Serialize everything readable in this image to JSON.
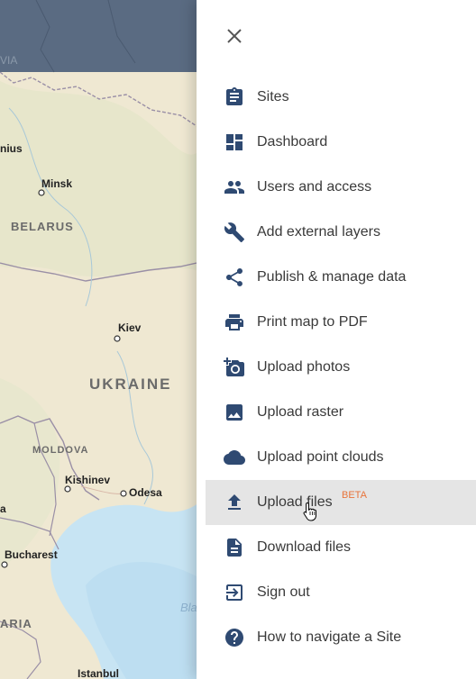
{
  "map": {
    "labels": {
      "via": "VIA",
      "nius": "nius",
      "minsk": "Minsk",
      "belarus": "BELARUS",
      "kiev": "Kiev",
      "ukraine": "UKRAINE",
      "moldova": "MOLDOVA",
      "kishinev": "Kishinev",
      "odesa": "Odesa",
      "bucharest": "Bucharest",
      "aria": "ARIA",
      "bla": "Bla",
      "istanbul": "Istanbul",
      "a": "a"
    },
    "colors": {
      "land": "#efe8d2",
      "water": "#c7e4f3",
      "overlay": "#5a6b82",
      "border": "#9a8fa6"
    }
  },
  "panel": {
    "close_icon": "close-icon",
    "icon_color": "#2f4a72",
    "items": [
      {
        "label": "Sites",
        "icon": "clipboard-icon"
      },
      {
        "label": "Dashboard",
        "icon": "dashboard-icon"
      },
      {
        "label": "Users and access",
        "icon": "users-icon"
      },
      {
        "label": "Add external layers",
        "icon": "wrench-icon"
      },
      {
        "label": "Publish & manage data",
        "icon": "share-icon"
      },
      {
        "label": "Print map to PDF",
        "icon": "printer-icon"
      },
      {
        "label": "Upload photos",
        "icon": "add-photo-icon"
      },
      {
        "label": "Upload raster",
        "icon": "image-icon"
      },
      {
        "label": "Upload point clouds",
        "icon": "cloud-icon"
      },
      {
        "label": "Upload files",
        "icon": "upload-icon",
        "badge": "BETA",
        "active": true
      },
      {
        "label": "Download files",
        "icon": "file-icon"
      },
      {
        "label": "Sign out",
        "icon": "sign-out-icon"
      },
      {
        "label": "How to navigate a Site",
        "icon": "help-icon"
      }
    ]
  }
}
